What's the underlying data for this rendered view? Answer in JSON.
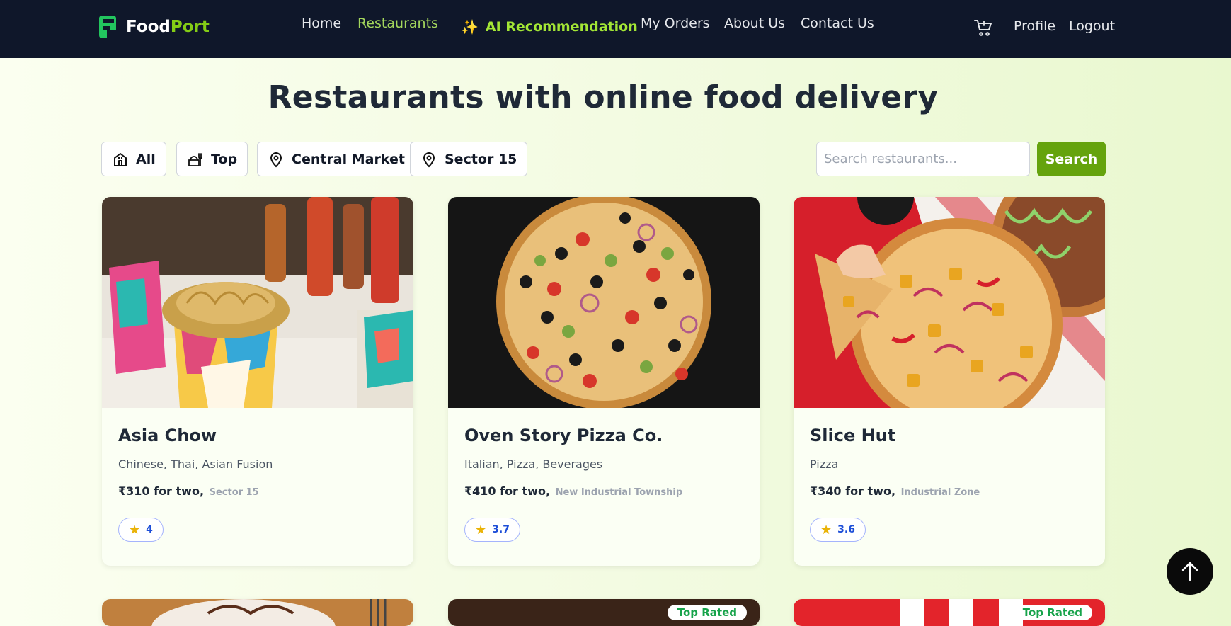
{
  "nav": {
    "logo_food": "Food",
    "logo_port": "Port",
    "home": "Home",
    "restaurants": "Restaurants",
    "ai_recommendation": "AI Recommendation",
    "ai_icon": "sparkles-icon",
    "my_orders": "My Orders",
    "about_us": "About Us",
    "contact_us": "Contact Us",
    "cart_icon": "cart-icon",
    "profile": "Profile",
    "logout": "Logout"
  },
  "page": {
    "title": "Restaurants with online food delivery"
  },
  "filters": {
    "all": "All",
    "top": "Top",
    "central_market": "Central Market",
    "sector_15": "Sector 15"
  },
  "search": {
    "placeholder": "Search restaurants...",
    "button": "Search"
  },
  "restaurants": [
    {
      "name": "Asia Chow",
      "cuisine": "Chinese, Thai, Asian Fusion",
      "price": "₹310 for two,",
      "location": "Sector 15",
      "rating": "4"
    },
    {
      "name": "Oven Story Pizza Co.",
      "cuisine": "Italian, Pizza, Beverages",
      "price": "₹410 for two,",
      "location": "New Industrial Township",
      "rating": "3.7"
    },
    {
      "name": "Slice Hut",
      "cuisine": "Pizza",
      "price": "₹340 for two,",
      "location": "Industrial Zone",
      "rating": "3.6"
    }
  ],
  "partial_cards": {
    "badge_2": "Top Rated",
    "badge_3": "Top Rated"
  },
  "colors": {
    "navbar": "#0f172a",
    "accent_green": "#65a30d",
    "active_link": "#a3d65c",
    "rating_text": "#1d4ed8"
  }
}
